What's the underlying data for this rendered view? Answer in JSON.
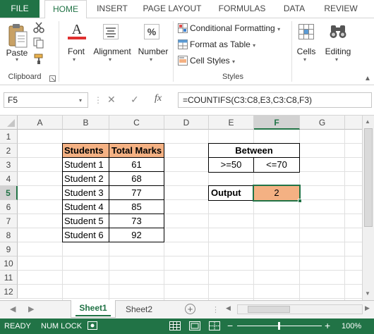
{
  "ribbon_tabs": [
    "FILE",
    "HOME",
    "INSERT",
    "PAGE LAYOUT",
    "FORMULAS",
    "DATA",
    "REVIEW"
  ],
  "ribbon": {
    "paste": "Paste",
    "clipboard": "Clipboard",
    "font": "Font",
    "alignment": "Alignment",
    "number": "Number",
    "conditional_formatting": "Conditional Formatting",
    "format_as_table": "Format as Table",
    "cell_styles": "Cell Styles",
    "styles": "Styles",
    "cells": "Cells",
    "editing": "Editing",
    "number_icon": "%",
    "font_icon": "A"
  },
  "formula_bar": {
    "name_box": "F5",
    "fx": "fx",
    "formula": "=COUNTIFS(C3:C8,E3,C3:C8,F3)"
  },
  "columns": [
    "A",
    "B",
    "C",
    "D",
    "E",
    "F",
    "G"
  ],
  "rows": [
    "1",
    "2",
    "3",
    "4",
    "5",
    "6",
    "7",
    "8",
    "9",
    "10",
    "11",
    "12"
  ],
  "table": {
    "headers": [
      "Students",
      "Total Marks"
    ],
    "rows": [
      [
        "Student 1",
        "61"
      ],
      [
        "Student 2",
        "68"
      ],
      [
        "Student 3",
        "77"
      ],
      [
        "Student 4",
        "85"
      ],
      [
        "Student 5",
        "73"
      ],
      [
        "Student 6",
        "92"
      ]
    ]
  },
  "between": {
    "title": "Between",
    "low": ">=50",
    "high": "<=70"
  },
  "output": {
    "label": "Output",
    "value": "2"
  },
  "sheets": [
    "Sheet1",
    "Sheet2"
  ],
  "status": {
    "ready": "READY",
    "numlock": "NUM LOCK",
    "zoom": "100%"
  },
  "colors": {
    "excel_green": "#217346",
    "header_fill": "#f4b183",
    "output_fill": "#f4b183"
  }
}
